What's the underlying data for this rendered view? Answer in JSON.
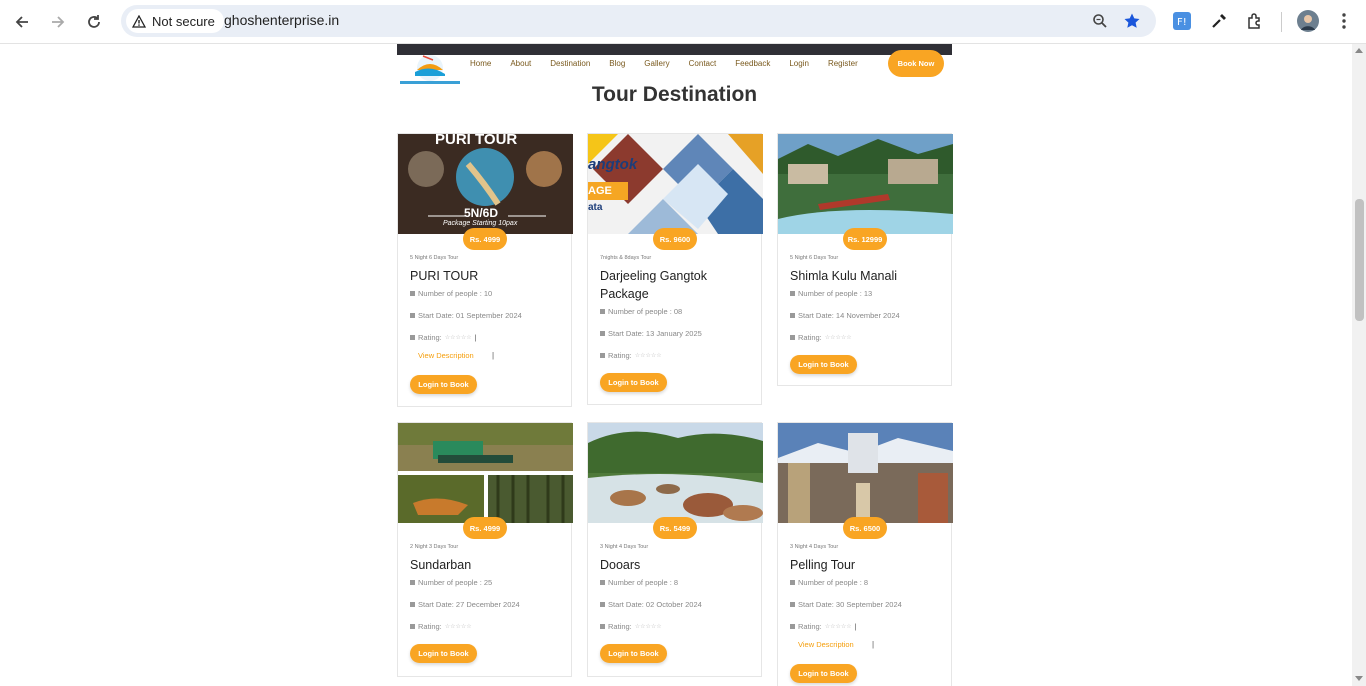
{
  "browser": {
    "security_label": "Not secure",
    "url": "ghoshenterprise.in"
  },
  "site": {
    "menu": [
      "Home",
      "About",
      "Destination",
      "Blog",
      "Gallery",
      "Contact",
      "Feedback",
      "Login",
      "Register"
    ],
    "book_now": "Book Now",
    "section_title": "Tour Destination"
  },
  "cards": [
    {
      "price": "Rs. 4999",
      "duration": "5 Night 6 Days Tour",
      "title": "PURI TOUR",
      "people": "Number of people : 10",
      "start": "Start Date: 01 September 2024",
      "rating": "Rating:",
      "rating_value": 0,
      "view_description": "View Description",
      "book": "Login to Book",
      "banner_title": "PURI TOUR",
      "banner_sub": "5N/6D",
      "banner_caption": "Package Starting 10pax"
    },
    {
      "price": "Rs. 9600",
      "duration": "7nights & 8days Tour",
      "title": "Darjeeling Gangtok Package",
      "people": "Number of people : 08",
      "start": "Start Date: 13 January 2025",
      "rating": "Rating:",
      "rating_value": 0,
      "book": "Login to Book",
      "banner_text_1": "angtok",
      "banner_text_2": "AGE",
      "banner_text_3": "ata"
    },
    {
      "price": "Rs. 12999",
      "duration": "5 Night 6 Days Tour",
      "title": "Shimla Kulu Manali",
      "people": "Number of people : 13",
      "start": "Start Date: 14 November 2024",
      "rating": "Rating:",
      "rating_value": 0,
      "book": "Login to Book"
    },
    {
      "price": "Rs. 4999",
      "duration": "2 Night 3 Days Tour",
      "title": "Sundarban",
      "people": "Number of people : 25",
      "start": "Start Date: 27 December 2024",
      "rating": "Rating:",
      "rating_value": 0,
      "book": "Login to Book"
    },
    {
      "price": "Rs. 5499",
      "duration": "3 Night 4 Days Tour",
      "title": "Dooars",
      "people": "Number of people : 8",
      "start": "Start Date: 02 October 2024",
      "rating": "Rating:",
      "rating_value": 0,
      "book": "Login to Book"
    },
    {
      "price": "Rs. 6500",
      "duration": "3 Night 4 Days Tour",
      "title": "Pelling Tour",
      "people": "Number of people : 8",
      "start": "Start Date: 30 September 2024",
      "rating": "Rating:",
      "rating_value": 0,
      "view_description": "View Description",
      "book": "Login to Book"
    }
  ],
  "colors": {
    "accent": "#f9a523",
    "header_band": "#2f2f36"
  },
  "icons": [
    "back-icon",
    "forward-icon",
    "reload-icon",
    "warning-icon",
    "zoom-icon",
    "star-icon",
    "extension-icon",
    "eyedropper-icon",
    "puzzle-icon",
    "avatar",
    "kebab-menu-icon"
  ]
}
